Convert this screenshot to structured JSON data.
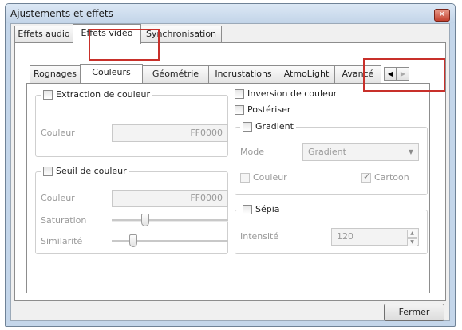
{
  "window": {
    "title": "Ajustements et effets",
    "close_glyph": "✕"
  },
  "main_tabs": [
    {
      "label": "Effets audio",
      "selected": false
    },
    {
      "label": "Effets vidéo",
      "selected": true
    },
    {
      "label": "Synchronisation",
      "selected": false
    }
  ],
  "sub_tabs": [
    {
      "label": "Rognages",
      "selected": false
    },
    {
      "label": "Couleurs",
      "selected": true
    },
    {
      "label": "Géométrie",
      "selected": false
    },
    {
      "label": "Incrustations",
      "selected": false
    },
    {
      "label": "AtmoLight",
      "selected": false
    },
    {
      "label": "Avancé",
      "selected": false
    }
  ],
  "tab_scroll": {
    "left_glyph": "◀",
    "right_glyph": "▶"
  },
  "color_extraction": {
    "label": "Extraction de couleur",
    "checked": false,
    "color_label": "Couleur",
    "color_value": "FF0000"
  },
  "color_threshold": {
    "label": "Seuil de couleur",
    "checked": false,
    "color_label": "Couleur",
    "color_value": "FF0000",
    "saturation_label": "Saturation",
    "saturation_value": 0.25,
    "similarity_label": "Similarité",
    "similarity_value": 0.15
  },
  "invert": {
    "label": "Inversion de couleur",
    "checked": false
  },
  "posterize": {
    "label": "Postériser",
    "checked": false
  },
  "gradient": {
    "label": "Gradient",
    "checked": false,
    "mode_label": "Mode",
    "mode_value": "Gradient",
    "dropdown_glyph": "▼",
    "color_label": "Couleur",
    "color_checked": false,
    "cartoon_label": "Cartoon",
    "cartoon_checked": true,
    "check_glyph": "✓"
  },
  "sepia": {
    "label": "Sépia",
    "checked": false,
    "intensity_label": "Intensité",
    "intensity_value": "120",
    "up_glyph": "▲",
    "down_glyph": "▼"
  },
  "footer": {
    "close_label": "Fermer"
  },
  "colors": {
    "highlight": "#c8302a",
    "title_bar": "#c4d6ea"
  }
}
